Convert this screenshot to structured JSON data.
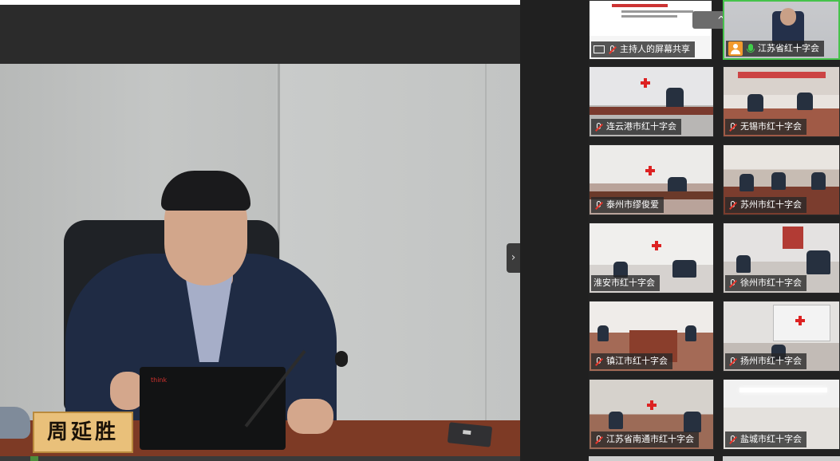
{
  "speaker": {
    "nameplate": "周延胜",
    "laptop_logo": "think"
  },
  "controls": {
    "collapse_panel_icon": "chevron-right-icon",
    "collapse_gallery_icon": "chevron-up-icon",
    "collapse_panel_glyph": "›",
    "collapse_gallery_glyph": "^"
  },
  "gallery": {
    "tiles": [
      {
        "label": "主持人的屏幕共享",
        "icon": "screen-share-icon",
        "mic": "muted"
      },
      {
        "label": "江苏省红十字会",
        "icon": "person-icon",
        "mic": "on",
        "active": true
      },
      {
        "label": "连云港市红十字会",
        "mic": "muted"
      },
      {
        "label": "无锡市红十字会",
        "mic": "muted"
      },
      {
        "label": "泰州市缪俊爱",
        "mic": "muted"
      },
      {
        "label": "苏州市红十字会",
        "mic": "muted"
      },
      {
        "label": "淮安市红十字会",
        "mic": "none"
      },
      {
        "label": "徐州市红十字会",
        "mic": "muted"
      },
      {
        "label": "镇江市红十字会",
        "mic": "muted"
      },
      {
        "label": "扬州市红十字会",
        "mic": "muted"
      },
      {
        "label": "江苏省南通市红十字会",
        "mic": "muted"
      },
      {
        "label": "盐城市红十字会",
        "mic": "muted"
      }
    ]
  },
  "colors": {
    "active_border": "#46c34b",
    "mic_on": "#3fcf4a",
    "mic_muted_slash": "#e4372c",
    "avatar_bg": "#f29a2e"
  }
}
